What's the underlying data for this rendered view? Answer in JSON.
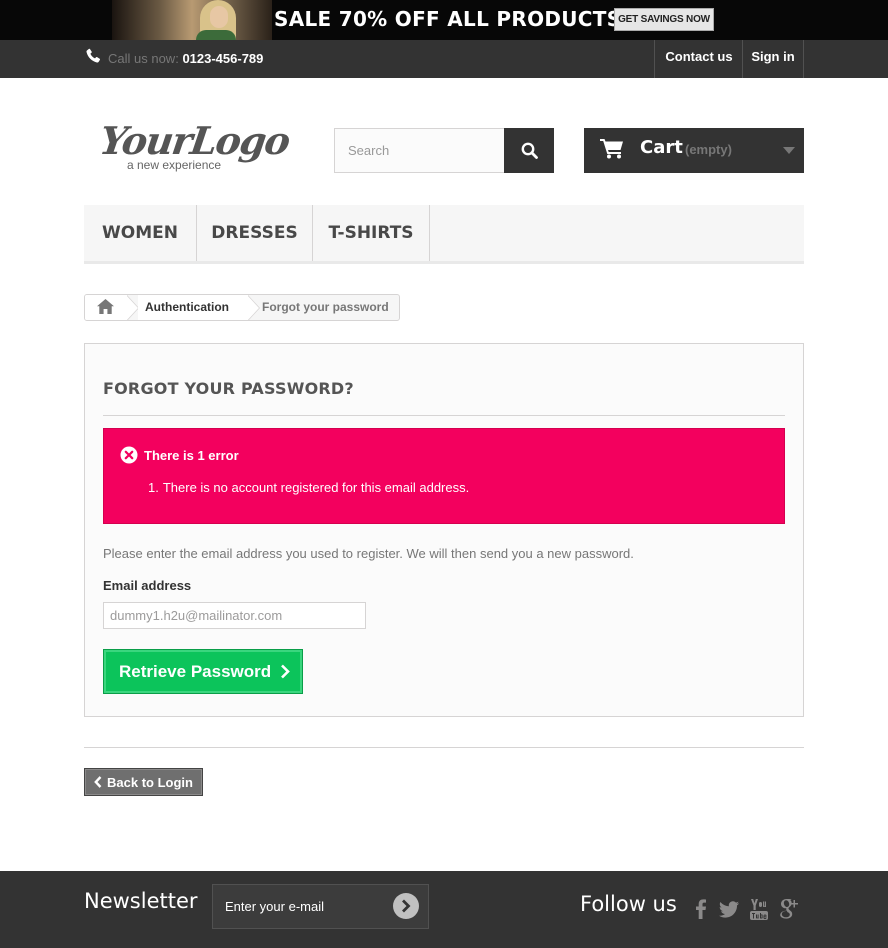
{
  "banner": {
    "headline": "SALE 70% OFF ALL PRODUCTS",
    "cta": "GET SAVINGS NOW"
  },
  "nav": {
    "call_prefix": "Call us now:",
    "phone": "0123-456-789",
    "contact": "Contact us",
    "sign_in": "Sign in"
  },
  "header": {
    "logo_main": "YourLogo",
    "logo_sub": "a new experience",
    "search_placeholder": "Search",
    "cart_label": "Cart",
    "cart_status": "(empty)"
  },
  "menu": {
    "items": [
      "WOMEN",
      "DRESSES",
      "T-SHIRTS"
    ]
  },
  "breadcrumb": {
    "parent": "Authentication",
    "current": "Forgot your password"
  },
  "main": {
    "heading": "FORGOT YOUR PASSWORD?",
    "error_title": "There is 1 error",
    "error_number": "1.",
    "error_message": "There is no account registered for this email address.",
    "instructions": "Please enter the email address you used to register. We will then send you a new password.",
    "email_label": "Email address",
    "email_value": "dummy1.h2u@mailinator.com",
    "submit_label": "Retrieve Password",
    "back_label": "Back to Login"
  },
  "footer": {
    "newsletter_title": "Newsletter",
    "newsletter_placeholder": "Enter your e-mail",
    "follow_title": "Follow us",
    "social_icons": [
      "facebook-icon",
      "twitter-icon",
      "youtube-icon",
      "google-plus-icon"
    ]
  },
  "colors": {
    "error_bg": "#f3005e",
    "success_btn": "#0cc45b",
    "dark_bar": "#333333"
  }
}
